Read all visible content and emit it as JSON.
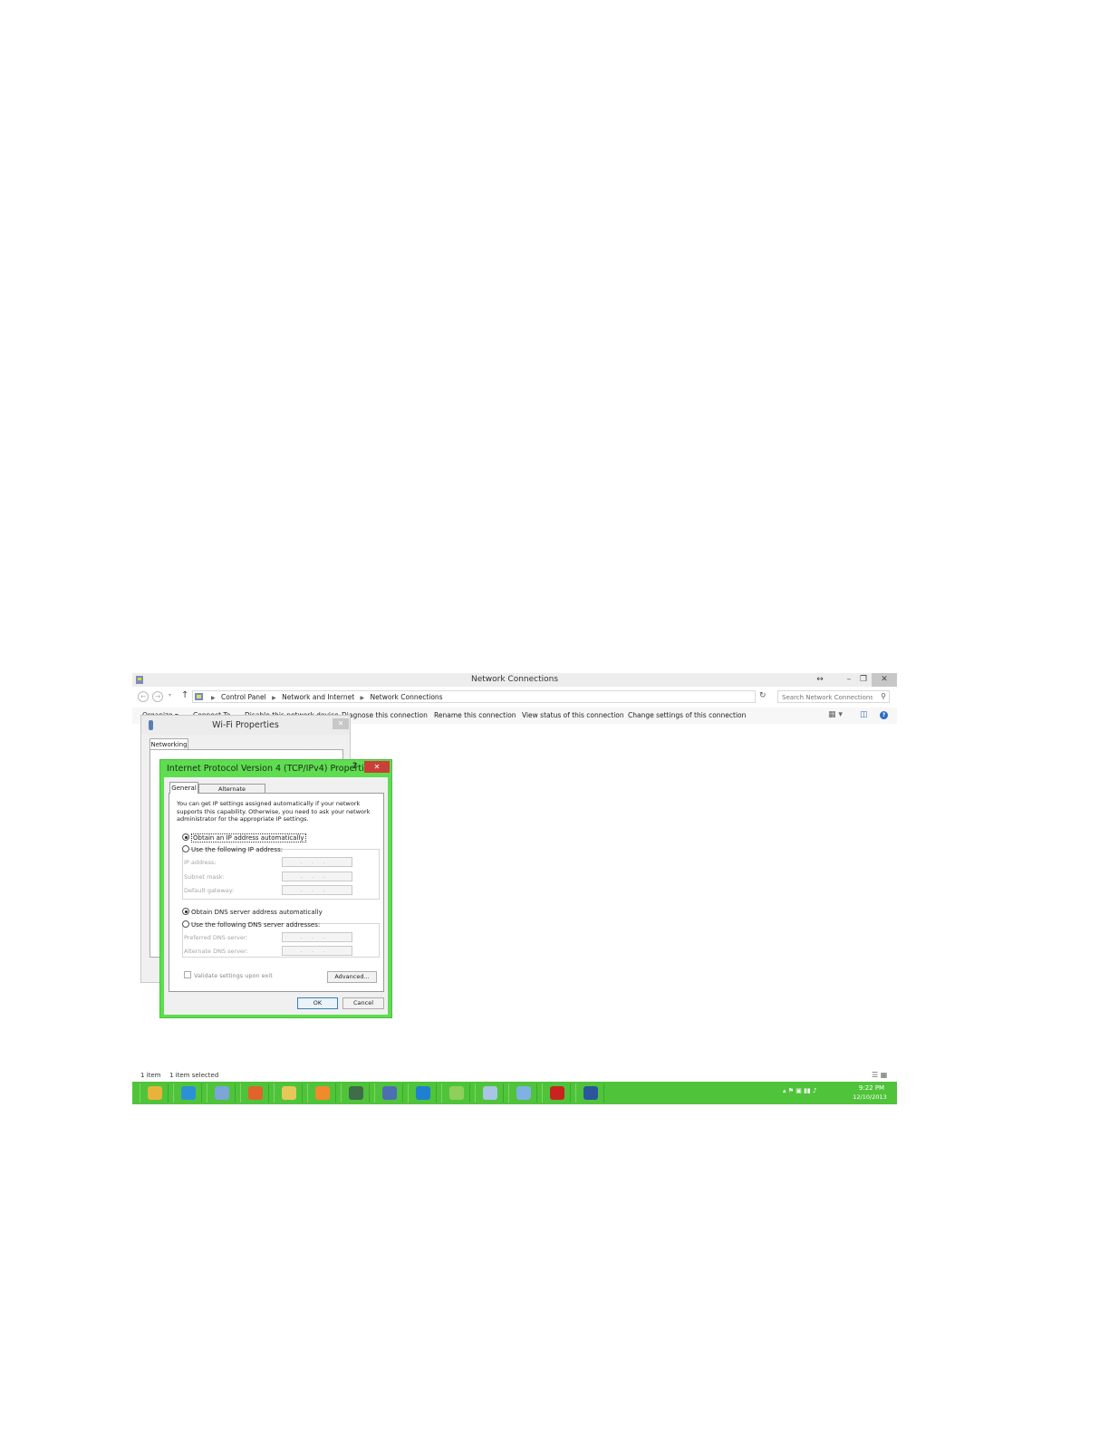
{
  "window": {
    "title": "Network Connections",
    "icon": "network-connections-icon",
    "controls": {
      "resize": "↔",
      "minimize": "–",
      "restore": "❐",
      "close": "✕"
    }
  },
  "address": {
    "back_icon": "back-arrow-icon",
    "forward_icon": "forward-arrow-icon",
    "up": "↑",
    "breadcrumbs": [
      "Control Panel",
      "Network and Internet",
      "Network Connections"
    ],
    "search_placeholder": "Search Network Connections"
  },
  "commands": {
    "organize": "Organize ▾",
    "connect_to": "Connect To",
    "disable": "Disable this network device",
    "diagnose": "Diagnose this connection",
    "rename": "Rename this connection",
    "view_status": "View status of this connection",
    "change_settings": "Change settings of this connection"
  },
  "statusbar": {
    "items": "1 item",
    "selected": "1 item selected"
  },
  "taskbar": {
    "apps": [
      {
        "name": "outlook",
        "color": "#e7b339"
      },
      {
        "name": "internet-explorer",
        "color": "#2d8fd6"
      },
      {
        "name": "windows-explorer-pane",
        "color": "#7aa7d8"
      },
      {
        "name": "firefox",
        "color": "#e0642b"
      },
      {
        "name": "file-explorer",
        "color": "#e8c75a"
      },
      {
        "name": "media-player",
        "color": "#f08a2a"
      },
      {
        "name": "network-app",
        "color": "#3f6c49"
      },
      {
        "name": "remote-desktop",
        "color": "#4b6fb0"
      },
      {
        "name": "teamviewer",
        "color": "#1f7fd1"
      },
      {
        "name": "games",
        "color": "#8ed05b"
      },
      {
        "name": "document-viewer",
        "color": "#a9c5e6"
      },
      {
        "name": "network-monitor",
        "color": "#7fb1e4"
      },
      {
        "name": "adobe-reader",
        "color": "#c8231f"
      },
      {
        "name": "word",
        "color": "#2b579a"
      }
    ],
    "time": "9:22 PM",
    "date": "12/10/2013"
  },
  "wifi_dialog": {
    "title": "Wi-Fi Properties",
    "close": "✕",
    "tab": "Networking"
  },
  "ipv4_dialog": {
    "title": "Internet Protocol Version 4 (TCP/IPv4) Properties",
    "help": "?",
    "close": "✕",
    "tabs": {
      "general": "General",
      "alternate": "Alternate Configuration"
    },
    "intro": "You can get IP settings assigned automatically if your network supports this capability. Otherwise, you need to ask your network administrator for the appropriate IP settings.",
    "ip_auto": "Obtain an IP address automatically",
    "ip_manual": "Use the following IP address:",
    "ip_address": "IP address:",
    "subnet_mask": "Subnet mask:",
    "default_gateway": "Default gateway:",
    "dns_auto": "Obtain DNS server address automatically",
    "dns_manual": "Use the following DNS server addresses:",
    "preferred_dns": "Preferred DNS server:",
    "alternate_dns": "Alternate DNS server:",
    "ip_placeholder": "...",
    "validate": "Validate settings upon exit",
    "advanced": "Advanced...",
    "ok": "OK",
    "cancel": "Cancel"
  }
}
